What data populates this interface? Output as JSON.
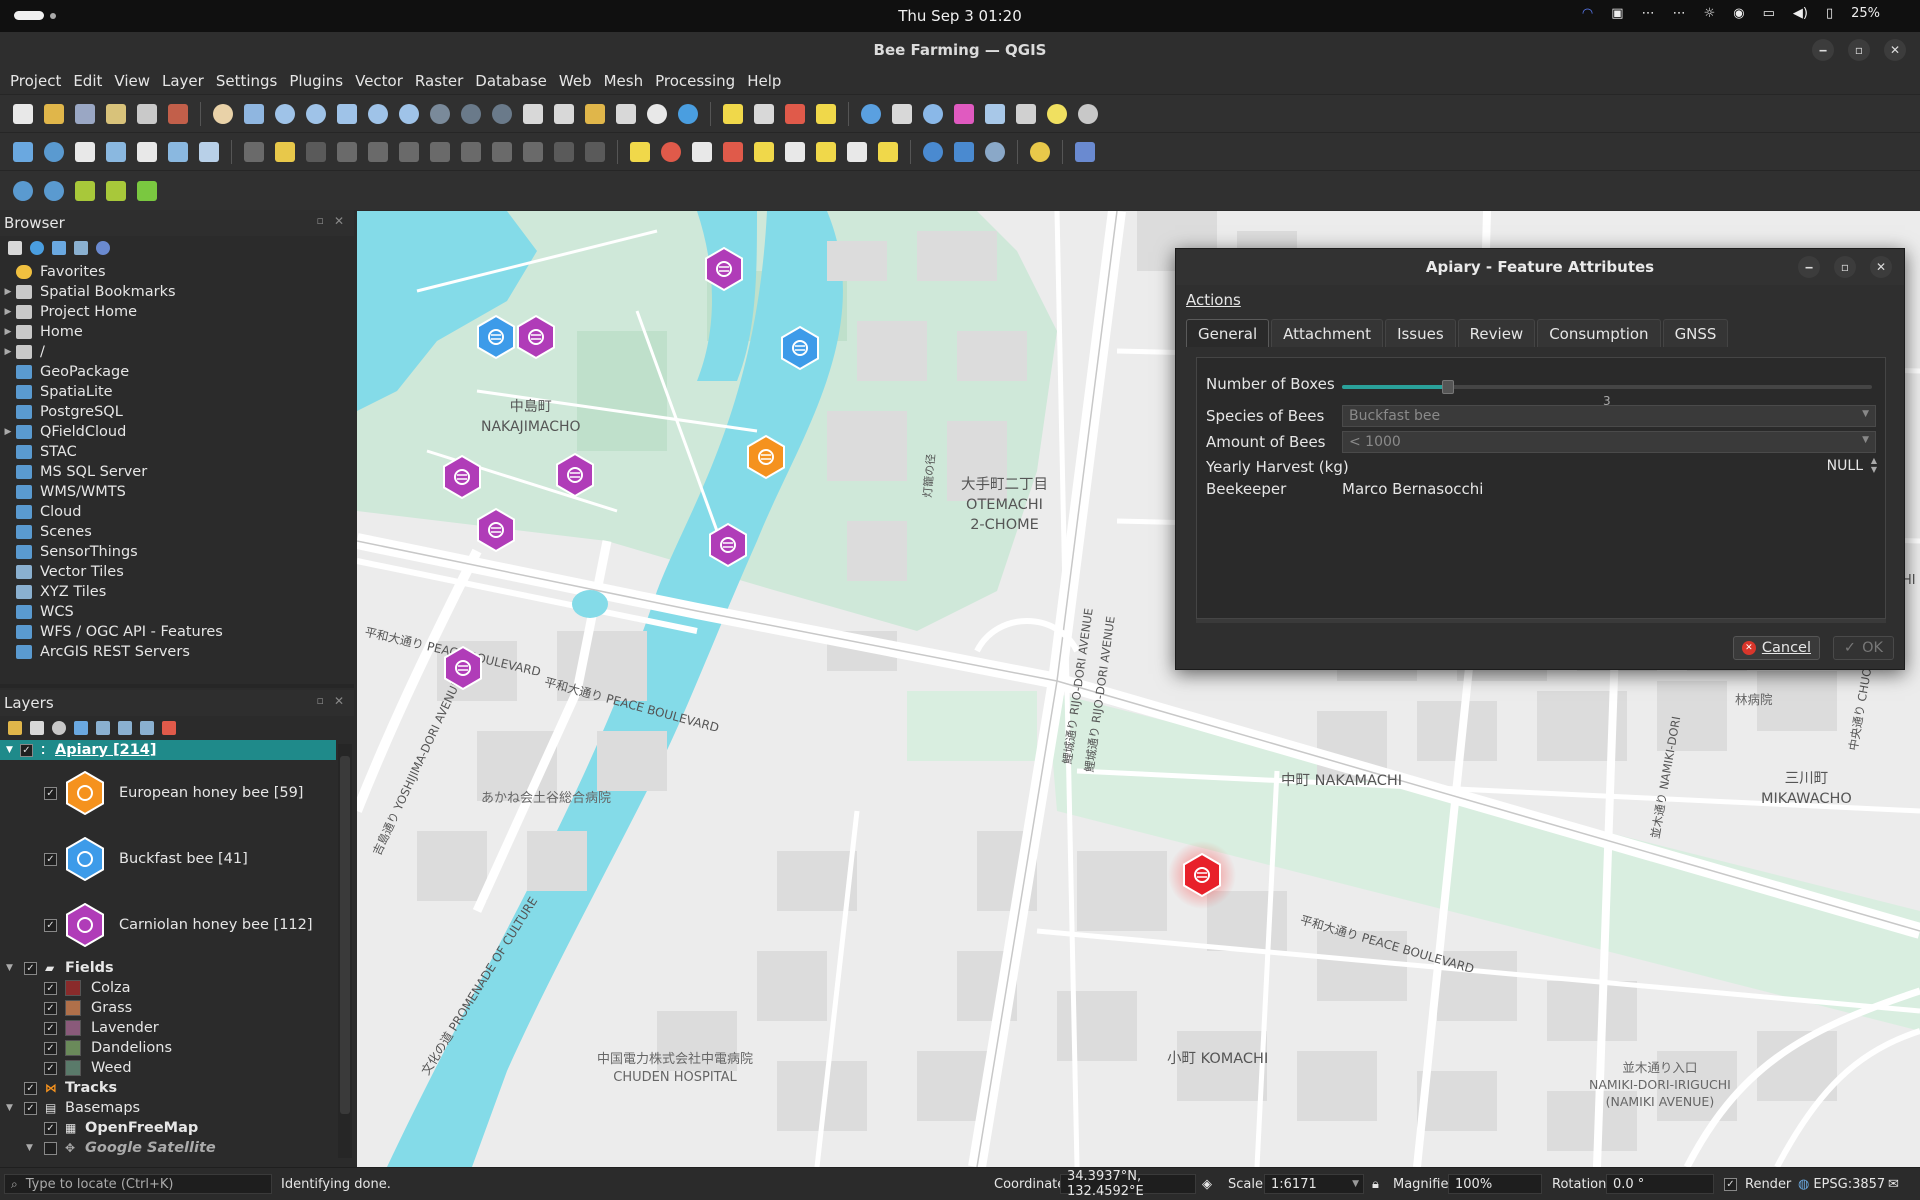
{
  "system_bar": {
    "datetime": "Thu Sep 3  01:20",
    "battery": "25%"
  },
  "window": {
    "title": "Bee Farming — QGIS"
  },
  "menu": [
    "Project",
    "Edit",
    "View",
    "Layer",
    "Settings",
    "Plugins",
    "Vector",
    "Raster",
    "Database",
    "Web",
    "Mesh",
    "Processing",
    "Help"
  ],
  "browser": {
    "title": "Browser",
    "items": [
      {
        "label": "Favorites",
        "icon": "star-icon",
        "expand": false
      },
      {
        "label": "Spatial Bookmarks",
        "icon": "bookmark-icon",
        "expand": true
      },
      {
        "label": "Project Home",
        "icon": "project-home-icon",
        "expand": true
      },
      {
        "label": "Home",
        "icon": "home-folder-icon",
        "expand": true
      },
      {
        "label": "/",
        "icon": "root-folder-icon",
        "expand": true
      },
      {
        "label": "GeoPackage",
        "icon": "geopackage-icon",
        "expand": false
      },
      {
        "label": "SpatiaLite",
        "icon": "spatialite-icon",
        "expand": false
      },
      {
        "label": "PostgreSQL",
        "icon": "postgresql-icon",
        "expand": false
      },
      {
        "label": "QFieldCloud",
        "icon": "qfieldcloud-icon",
        "expand": true
      },
      {
        "label": "STAC",
        "icon": "stac-icon",
        "expand": false
      },
      {
        "label": "MS SQL Server",
        "icon": "mssql-icon",
        "expand": false
      },
      {
        "label": "WMS/WMTS",
        "icon": "wms-icon",
        "expand": false
      },
      {
        "label": "Cloud",
        "icon": "cloud-icon",
        "expand": false
      },
      {
        "label": "Scenes",
        "icon": "scenes-icon",
        "expand": false
      },
      {
        "label": "SensorThings",
        "icon": "sensorthings-icon",
        "expand": false
      },
      {
        "label": "Vector Tiles",
        "icon": "vector-tiles-icon",
        "expand": false
      },
      {
        "label": "XYZ Tiles",
        "icon": "xyz-tiles-icon",
        "expand": false
      },
      {
        "label": "WCS",
        "icon": "wcs-icon",
        "expand": false
      },
      {
        "label": "WFS / OGC API - Features",
        "icon": "wfs-icon",
        "expand": false
      },
      {
        "label": "ArcGIS REST Servers",
        "icon": "arcgis-icon",
        "expand": false
      }
    ]
  },
  "layers": {
    "title": "Layers",
    "apiary": {
      "label": "Apiary [214]",
      "classes": [
        {
          "label": "European honey bee [59]",
          "color": "#f5921e"
        },
        {
          "label": "Buckfast bee [41]",
          "color": "#3d9be9"
        },
        {
          "label": "Carniolan honey bee [112]",
          "color": "#b03cb8"
        }
      ]
    },
    "fields": {
      "label": "Fields",
      "classes": [
        {
          "label": "Colza",
          "color": "#8a2b2b"
        },
        {
          "label": "Grass",
          "color": "#b0704a"
        },
        {
          "label": "Lavender",
          "color": "#8a5a7a"
        },
        {
          "label": "Dandelions",
          "color": "#6a8a5a"
        },
        {
          "label": "Weed",
          "color": "#5a7a6a"
        }
      ]
    },
    "tracks": {
      "label": "Tracks"
    },
    "basemaps": {
      "label": "Basemaps",
      "items": [
        "OpenFreeMap",
        "Google Satellite"
      ]
    }
  },
  "map": {
    "labels": {
      "nakajimacho_jp": "中島町",
      "nakajimacho": "NAKAJIMACHO",
      "otemachi_jp": "大手町二丁目",
      "otemachi": "OTEMACHI",
      "otemachi_chome": "2-CHOME",
      "nakamachi": "中町 NAKAMACHI",
      "mikawacho_jp": "三川町",
      "mikawacho": "MIKAWACHO",
      "komachi": "小町 KOMACHI",
      "hospital_jp": "中国電力株式会社中電病院",
      "hospital": "CHUDEN HOSPITAL",
      "hospital2": "あかね会土谷総合病院",
      "namiki_jp": "並木通り入口",
      "namiki": "NAMIKI-DORI-IRIGUCHI",
      "namiki_ave": "(NAMIKI AVENUE)",
      "peace_blvd": "平和大通り PEACE BOULEVARD",
      "peace_blvd2": "平和大通り PEACE BOULEVARD",
      "peace_blvd_jp": "平和大通り",
      "peace_blvd_short": "PEACE BOULEVARD",
      "promenade": "文化の道 PROMENADE OF CULTURE",
      "yoshijima": "吉島通り YOSHIJIMA-DORI AVENUE",
      "rijo": "鯉城通り RIJO-DORI AVENUE",
      "namiki_dori": "並木通り NAMIKI-DORI",
      "chuo": "中央通り CHUO-D",
      "tourou": "灯籠の径",
      "rinbyoin": "林病院",
      "hi_edge": "HI"
    }
  },
  "dialog": {
    "title": "Apiary - Feature Attributes",
    "actions_label": "Actions",
    "tabs": [
      "General",
      "Attachment",
      "Issues",
      "Review",
      "Consumption",
      "GNSS"
    ],
    "fields": {
      "boxes_label": "Number of Boxes",
      "boxes_value": "3",
      "boxes_fraction": 0.2,
      "species_label": "Species of Bees",
      "species_value": "Buckfast bee",
      "amount_label": "Amount of Bees",
      "amount_value": "< 1000",
      "harvest_label": "Yearly Harvest (kg)",
      "harvest_value": "NULL",
      "beekeeper_label": "Beekeeper",
      "beekeeper_value": "Marco Bernasocchi"
    },
    "cancel_label": "Cancel",
    "ok_label": "OK"
  },
  "statusbar": {
    "locate_placeholder": "Type to locate (Ctrl+K)",
    "message": "Identifying done.",
    "coordinate_label": "Coordinate",
    "coordinate_value": "34.3937°N, 132.4592°E",
    "scale_label": "Scale",
    "scale_value": "1:6171",
    "magnifier_label": "Magnifier",
    "magnifier_value": "100%",
    "rotation_label": "Rotation",
    "rotation_value": "0.0 °",
    "render_label": "Render",
    "crs": "EPSG:3857"
  },
  "colors": {
    "european": "#f5921e",
    "buckfast": "#3d9be9",
    "carniolan": "#b03cb8",
    "selected": "#e8202a",
    "water": "#84dbe8",
    "park": "#cfe8d9",
    "accent": "#1f8a8a"
  }
}
